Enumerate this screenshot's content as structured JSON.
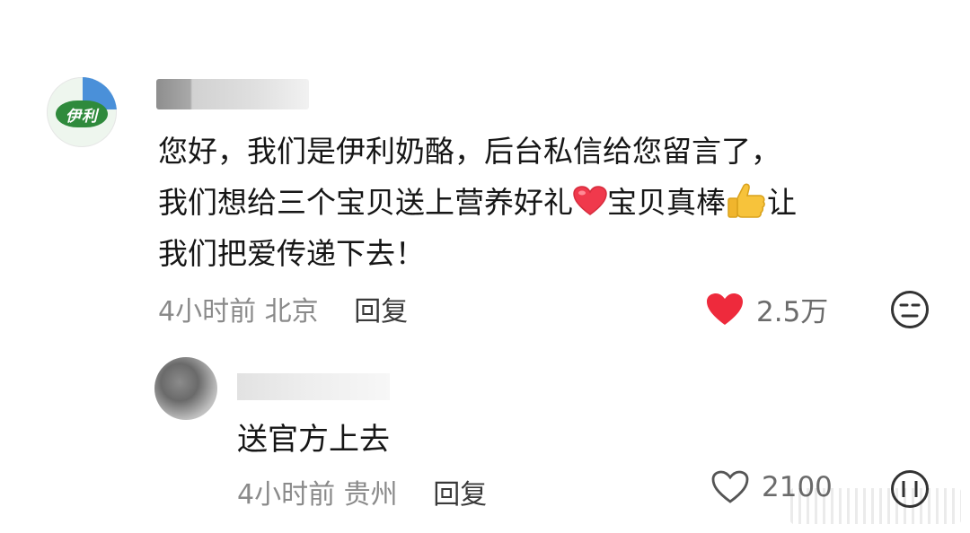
{
  "comment": {
    "avatar_logo_text": "伊利",
    "line1": "您好，我们是伊利奶酪，后台私信给您留言了，",
    "line2_before_heart": "我们想给三个宝贝送上营养好礼",
    "line2_after_heart": "宝贝真棒",
    "line2_after_thumb": "让",
    "line3": "我们把爱传递下去！",
    "time": "4小时前",
    "location": "北京",
    "reply_label": "回复",
    "likes": "2.5万",
    "like_icon": "heart-filled-icon",
    "like_color": "#ee2a3c"
  },
  "reply": {
    "text": "送官方上去",
    "time": "4小时前",
    "location": "贵州",
    "reply_label": "回复",
    "likes": "2100",
    "like_icon": "heart-outline-icon"
  }
}
